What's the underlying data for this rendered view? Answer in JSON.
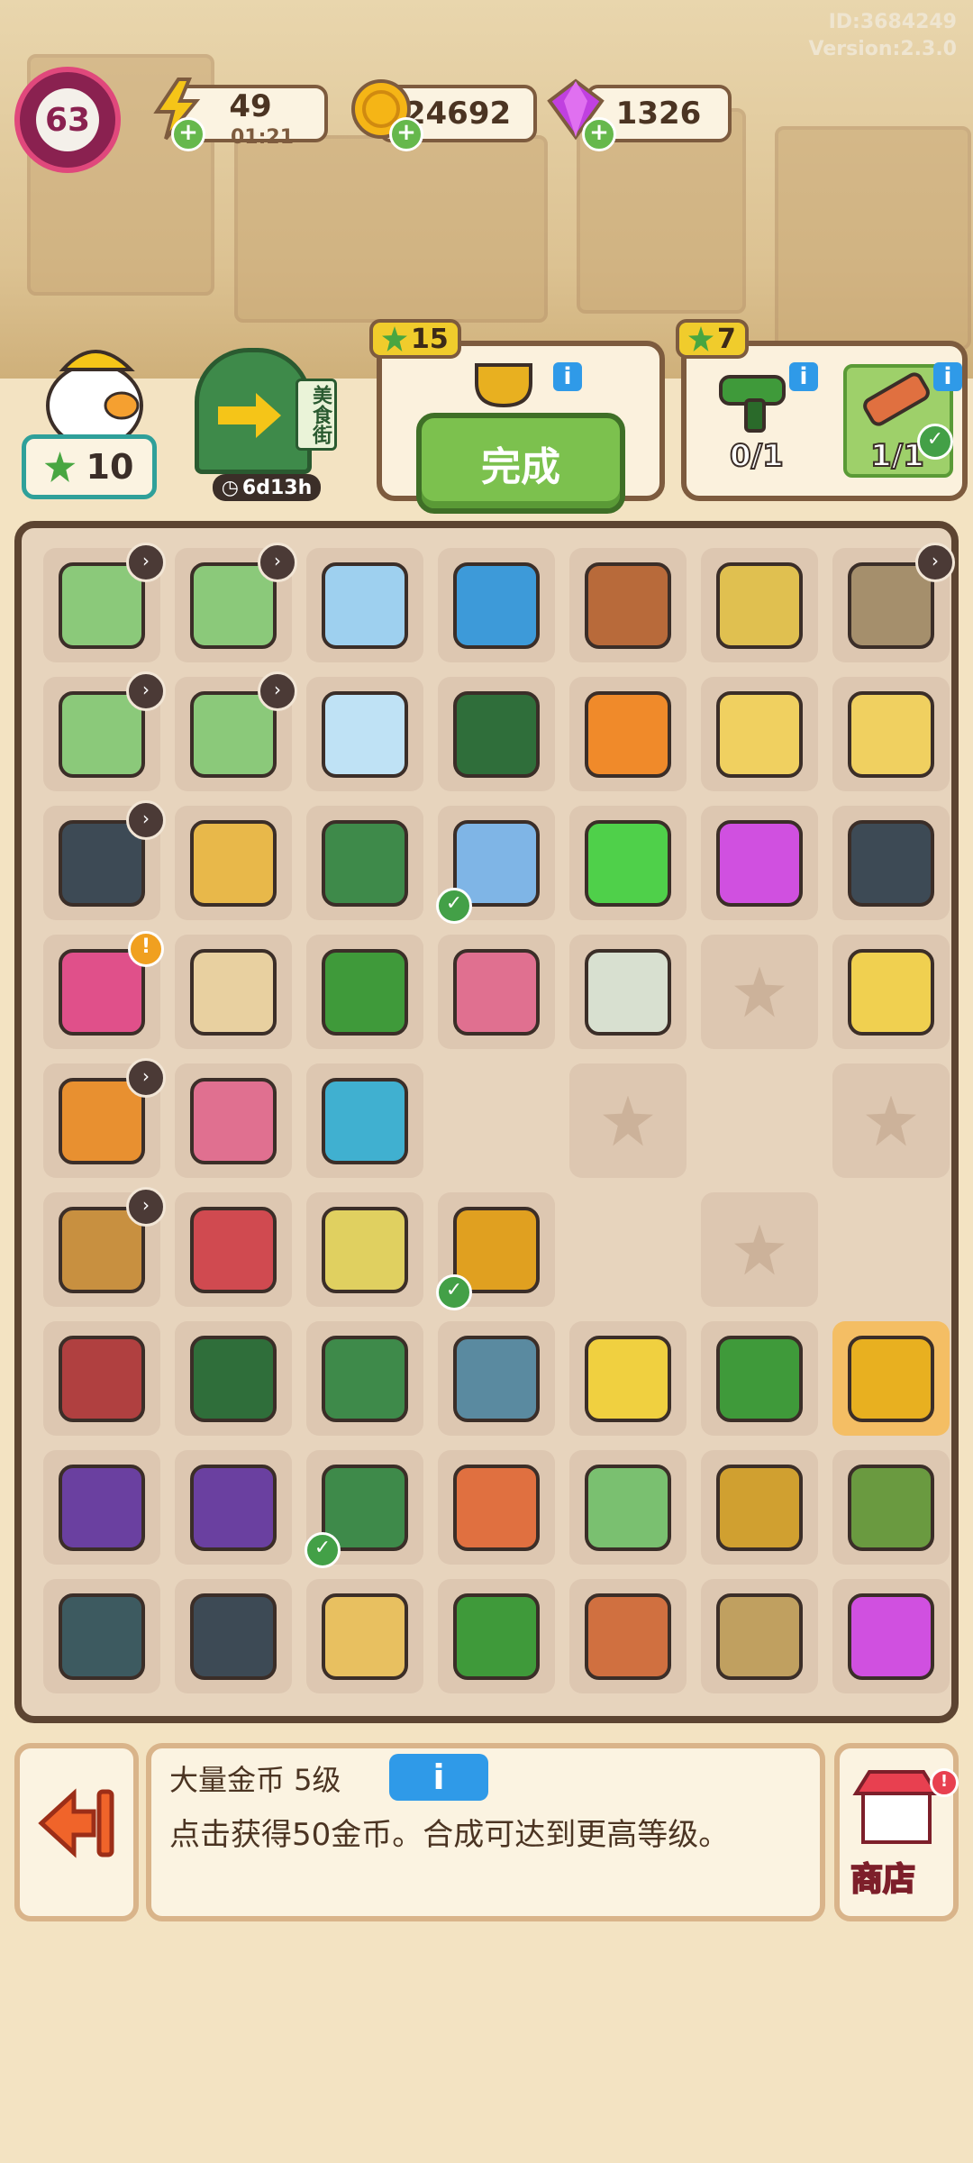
{
  "meta": {
    "id": "ID:3684249",
    "version": "Version:2.3.0"
  },
  "player": {
    "level": "63"
  },
  "resources": {
    "energy": {
      "value": "49",
      "timer": "01:21",
      "icon": "lightning-icon",
      "color": "#f5c518"
    },
    "coins": {
      "value": "24692",
      "icon": "coin-icon",
      "color": "#f5b516"
    },
    "gems": {
      "value": "1326",
      "icon": "gem-icon",
      "color": "#c040e0"
    }
  },
  "worker": {
    "stars": "10"
  },
  "event": {
    "name": "美食街",
    "timer": "6d13h"
  },
  "quests": [
    {
      "reward": "15",
      "button": "完成",
      "item_icon": "trophy-icon"
    },
    {
      "reward": "7",
      "items": [
        {
          "icon": "drill-icon",
          "progress": "0/1"
        },
        {
          "icon": "box-cutter-icon",
          "progress": "1/1"
        }
      ]
    }
  ],
  "board": {
    "rows": [
      [
        {
          "n": "laptop",
          "c": "#8bc97a",
          "cd": true
        },
        {
          "n": "laptop",
          "c": "#8bc97a",
          "cd": true
        },
        {
          "n": "coffee-machine",
          "c": "#9ed0ef"
        },
        {
          "n": "robot-vacuum",
          "c": "#3d9ad9"
        },
        {
          "n": "wood-chunk",
          "c": "#b86a3a"
        },
        {
          "n": "shopping-cart-wood",
          "c": "#e0c050"
        },
        {
          "n": "locker-cabinet",
          "c": "#a58f6c",
          "cd": true
        }
      ],
      [
        {
          "n": "laptop",
          "c": "#8bc97a",
          "cd": true
        },
        {
          "n": "laptop",
          "c": "#8bc97a",
          "cd": true
        },
        {
          "n": "robot-vacuum",
          "c": "#bfe2f5"
        },
        {
          "n": "green-case",
          "c": "#2f6e3a"
        },
        {
          "n": "book",
          "c": "#f08a2a"
        },
        {
          "n": "duck-cart",
          "c": "#f0d060"
        },
        {
          "n": "duck-cart",
          "c": "#f0d060"
        }
      ],
      [
        {
          "n": "gym-weights-basket",
          "c": "#3d4a55",
          "cd": true
        },
        {
          "n": "plant-pot",
          "c": "#e8b84a"
        },
        {
          "n": "toolbox",
          "c": "#3e8a4a"
        },
        {
          "n": "card-pack",
          "c": "#7fb5e6",
          "ok": true
        },
        {
          "n": "energy-plus-5",
          "c": "#4fd04a"
        },
        {
          "n": "gems",
          "c": "#d050e0"
        },
        {
          "n": "weight-plates",
          "c": "#3d4a55"
        }
      ],
      [
        {
          "n": "backpack",
          "c": "#e0508a",
          "warn": true
        },
        {
          "n": "paint-can",
          "c": "#e8d0a0"
        },
        {
          "n": "wrench-handle",
          "c": "#3f9a3a"
        },
        {
          "n": "brick",
          "c": "#e07090"
        },
        {
          "n": "glue-tube",
          "c": "#d8e0d0"
        },
        {
          "n": "empty"
        },
        {
          "n": "duck-chick",
          "c": "#f0d050"
        }
      ],
      [
        {
          "n": "flower-basket",
          "c": "#e89030",
          "cd": true
        },
        {
          "n": "bricks",
          "c": "#e07090"
        },
        {
          "n": "resistance-band",
          "c": "#40b0d0"
        },
        {
          "n": "blank"
        },
        {
          "n": "empty"
        },
        {
          "n": "blank"
        },
        {
          "n": "empty"
        }
      ],
      [
        {
          "n": "flower-basket-yellow",
          "c": "#c89040",
          "cd": true
        },
        {
          "n": "tool-bucket",
          "c": "#d04a50"
        },
        {
          "n": "jump-rope",
          "c": "#e0d060"
        },
        {
          "n": "trophy",
          "c": "#e0a020",
          "ok": true
        },
        {
          "n": "blank"
        },
        {
          "n": "empty"
        },
        {
          "n": "blank"
        }
      ],
      [
        {
          "n": "tool-wheelbarrow",
          "c": "#b04040"
        },
        {
          "n": "green-tool-chest",
          "c": "#2f6e3a"
        },
        {
          "n": "tool-case-open",
          "c": "#3e8a4a"
        },
        {
          "n": "weight-bench",
          "c": "#5a8aa0"
        },
        {
          "n": "paint-bucket",
          "c": "#f0d040"
        },
        {
          "n": "pliers",
          "c": "#3f9a3a"
        },
        {
          "n": "coin-pile",
          "c": "#e8b020",
          "gold": true
        }
      ],
      [
        {
          "n": "dumbbell-box",
          "c": "#6a40a0"
        },
        {
          "n": "boxing-box",
          "c": "#6a40a0"
        },
        {
          "n": "tool-case-open",
          "c": "#3e8a4a",
          "ok": true
        },
        {
          "n": "box-cutter",
          "c": "#e07040"
        },
        {
          "n": "cash",
          "c": "#7ac070"
        },
        {
          "n": "medal",
          "c": "#d0a030"
        },
        {
          "n": "coin-sack",
          "c": "#6a9a40"
        }
      ],
      [
        {
          "n": "punching-bag",
          "c": "#3d5a60"
        },
        {
          "n": "boxing-gloves",
          "c": "#3d4a55"
        },
        {
          "n": "paint-bucket-empty",
          "c": "#e8c060"
        },
        {
          "n": "adjustable-wrench",
          "c": "#3f9a3a"
        },
        {
          "n": "hammer",
          "c": "#d07040"
        },
        {
          "n": "seed-bag",
          "c": "#c0a060"
        },
        {
          "n": "gems-small",
          "c": "#d050e0"
        }
      ]
    ]
  },
  "selection": {
    "title": "大量金币 5级",
    "info_label": "i",
    "description": "点击获得50金币。合成可达到更高等级。"
  },
  "shop": {
    "label": "商店"
  }
}
